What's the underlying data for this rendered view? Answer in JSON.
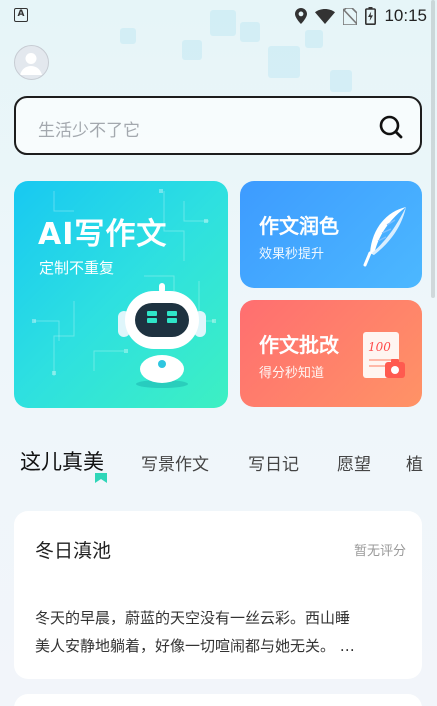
{
  "status_bar": {
    "left_icon_letter": "A",
    "time": "10:15",
    "icons": [
      "location-icon",
      "wifi-icon",
      "no-sim-icon",
      "battery-charging-icon"
    ]
  },
  "search": {
    "placeholder": "生活少不了它",
    "icon": "search-icon"
  },
  "cards": {
    "ai": {
      "title": "AI写作文",
      "subtitle": "定制不重复"
    },
    "polish": {
      "title": "作文润色",
      "subtitle": "效果秒提升"
    },
    "grade": {
      "title": "作文批改",
      "subtitle": "得分秒知道",
      "paper_score": "100"
    }
  },
  "tabs": [
    {
      "label": "这儿真美",
      "active": true
    },
    {
      "label": "写景作文",
      "active": false
    },
    {
      "label": "写日记",
      "active": false
    },
    {
      "label": "愿望",
      "active": false
    },
    {
      "label": "植",
      "active": false
    }
  ],
  "article": {
    "title": "冬日滇池",
    "rating": "暂无评分",
    "lines": [
      "冬天的早晨，蔚蓝的天空没有一丝云彩。西山睡",
      "美人安静地躺着，好像一切喧闹都与她无关。 …"
    ]
  },
  "colors": {
    "ai_card": "#1fd3ea",
    "polish_card": "#3d9bff",
    "grade_card": "#ff6e70",
    "tab_indicator": "#2fd6b8"
  }
}
